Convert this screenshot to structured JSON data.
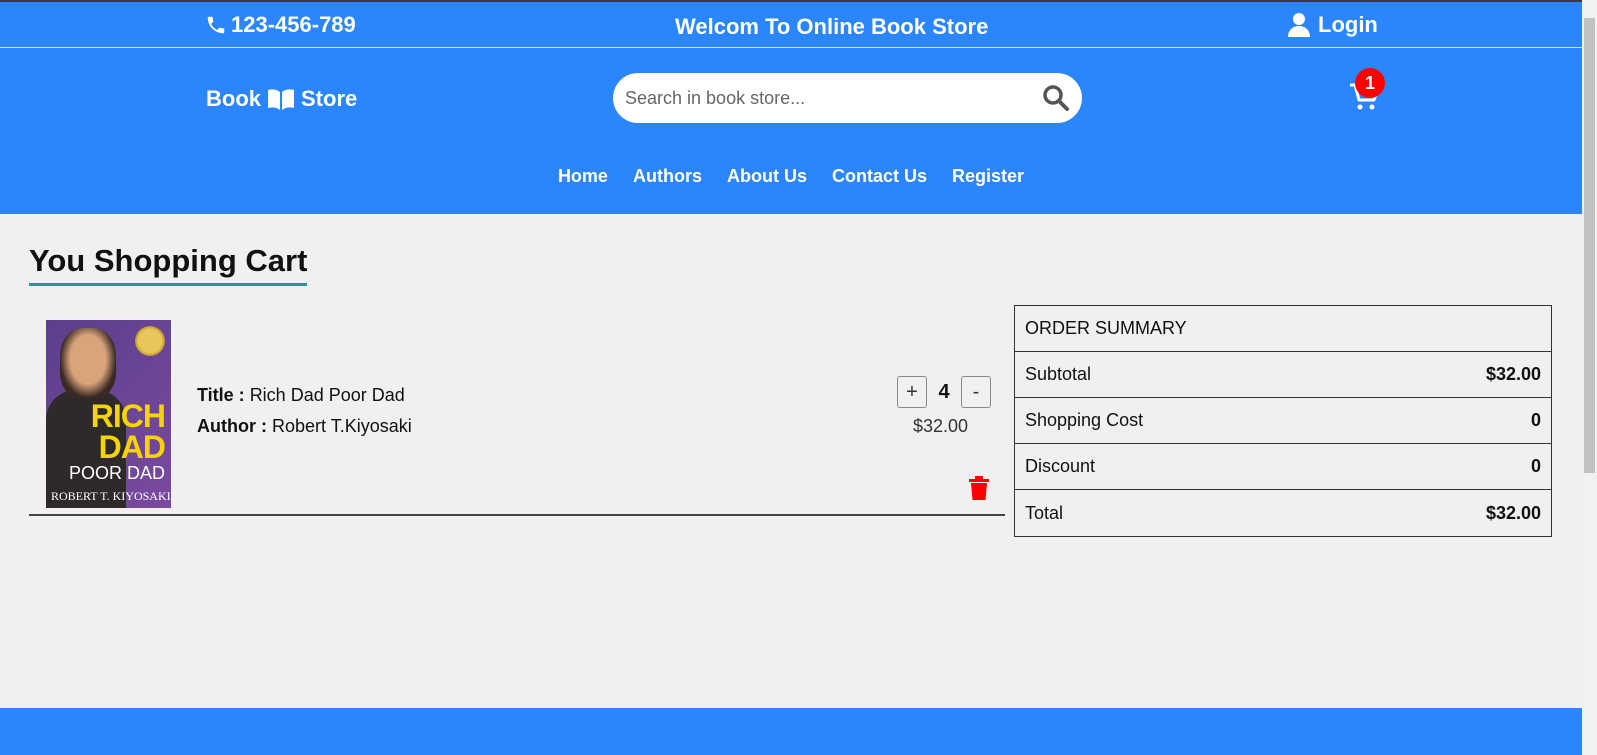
{
  "top_bar": {
    "phone": "123-456-789",
    "welcome": "Welcom To Online Book Store",
    "login": "Login"
  },
  "header": {
    "logo_left": "Book",
    "logo_right": "Store",
    "search_placeholder": "Search in book store...",
    "cart_count": "1"
  },
  "nav": {
    "items": [
      "Home",
      "Authors",
      "About Us",
      "Contact Us",
      "Register"
    ]
  },
  "page_title": "You Shopping Cart",
  "cart_item": {
    "cover_lines": [
      "RICH",
      "DAD",
      "POOR DAD",
      "ROBERT T. KIYOSAKI"
    ],
    "title_label": "Title :",
    "title": "Rich Dad Poor Dad",
    "author_label": "Author :",
    "author": "Robert T.Kiyosaki",
    "plus": "+",
    "minus": "-",
    "quantity": "4",
    "price": "$32.00"
  },
  "summary": {
    "heading": "ORDER SUMMARY",
    "rows": [
      {
        "label": "Subtotal",
        "value": "$32.00"
      },
      {
        "label": "Shopping Cost",
        "value": "0"
      },
      {
        "label": "Discount",
        "value": "0"
      },
      {
        "label": "Total",
        "value": "$32.00"
      }
    ]
  },
  "colors": {
    "brand": "#2b85fd",
    "badge": "#ff0000",
    "title_underline": "#1a9aa0",
    "trash": "#ff0000"
  },
  "icons": [
    "phone-icon",
    "user-icon",
    "book-open-icon",
    "search-icon",
    "cart-icon",
    "trash-icon"
  ]
}
